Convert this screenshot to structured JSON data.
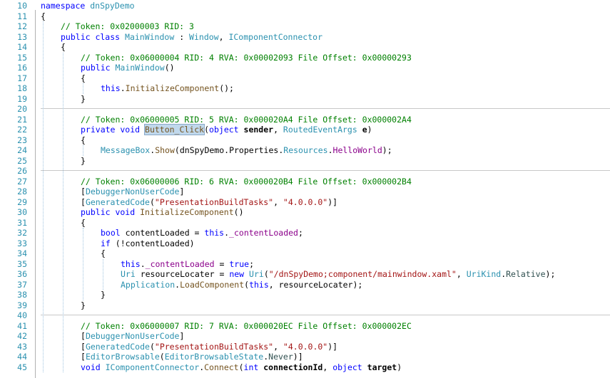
{
  "editor": {
    "lines": [
      {
        "n": "10",
        "indent": 0,
        "tokens": [
          {
            "t": "namespace",
            "c": "kw"
          },
          {
            "t": " dnSpyDemo",
            "c": "ty"
          }
        ]
      },
      {
        "n": "11",
        "indent": 0,
        "tokens": [
          {
            "t": "{",
            "c": "df"
          }
        ]
      },
      {
        "n": "12",
        "indent": 1,
        "tokens": [
          {
            "t": "// Token: 0x02000003 RID: 3",
            "c": "cm"
          }
        ]
      },
      {
        "n": "13",
        "indent": 1,
        "tokens": [
          {
            "t": "public class ",
            "c": "kw"
          },
          {
            "t": "MainWindow",
            "c": "ty"
          },
          {
            "t": " : ",
            "c": "df"
          },
          {
            "t": "Window",
            "c": "ty"
          },
          {
            "t": ", ",
            "c": "df"
          },
          {
            "t": "IComponentConnector",
            "c": "ty"
          }
        ]
      },
      {
        "n": "14",
        "indent": 1,
        "tokens": [
          {
            "t": "{",
            "c": "df"
          }
        ]
      },
      {
        "n": "15",
        "indent": 2,
        "tokens": [
          {
            "t": "// Token: 0x06000004 RID: 4 RVA: 0x00002093 File Offset: 0x00000293",
            "c": "cm"
          }
        ]
      },
      {
        "n": "16",
        "indent": 2,
        "tokens": [
          {
            "t": "public ",
            "c": "kw"
          },
          {
            "t": "MainWindow",
            "c": "ty"
          },
          {
            "t": "()",
            "c": "df"
          }
        ]
      },
      {
        "n": "17",
        "indent": 2,
        "tokens": [
          {
            "t": "{",
            "c": "df"
          }
        ]
      },
      {
        "n": "18",
        "indent": 3,
        "tokens": [
          {
            "t": "this",
            "c": "kw"
          },
          {
            "t": ".",
            "c": "df"
          },
          {
            "t": "InitializeComponent",
            "c": "mt"
          },
          {
            "t": "();",
            "c": "df"
          }
        ]
      },
      {
        "n": "19",
        "indent": 2,
        "tokens": [
          {
            "t": "}",
            "c": "df"
          }
        ]
      },
      {
        "n": "20",
        "indent": 0,
        "sep": true,
        "tokens": []
      },
      {
        "n": "21",
        "indent": 2,
        "tokens": [
          {
            "t": "// Token: 0x06000005 RID: 5 RVA: 0x000020A4 File Offset: 0x000002A4",
            "c": "cm"
          }
        ]
      },
      {
        "n": "22",
        "indent": 2,
        "tokens": [
          {
            "t": "private void ",
            "c": "kw"
          },
          {
            "t": "Button_Click",
            "c": "mt hl"
          },
          {
            "t": "(",
            "c": "df"
          },
          {
            "t": "object ",
            "c": "kw"
          },
          {
            "t": "sender",
            "c": "df bold"
          },
          {
            "t": ", ",
            "c": "df"
          },
          {
            "t": "RoutedEventArgs ",
            "c": "ty"
          },
          {
            "t": "e",
            "c": "df bold"
          },
          {
            "t": ")",
            "c": "df"
          }
        ]
      },
      {
        "n": "23",
        "indent": 2,
        "tokens": [
          {
            "t": "{",
            "c": "df"
          }
        ]
      },
      {
        "n": "24",
        "indent": 3,
        "tokens": [
          {
            "t": "MessageBox",
            "c": "ty"
          },
          {
            "t": ".",
            "c": "df"
          },
          {
            "t": "Show",
            "c": "mt"
          },
          {
            "t": "(",
            "c": "df"
          },
          {
            "t": "dnSpyDemo",
            "c": "df"
          },
          {
            "t": ".",
            "c": "df"
          },
          {
            "t": "Properties",
            "c": "df"
          },
          {
            "t": ".",
            "c": "df"
          },
          {
            "t": "Resources",
            "c": "ty"
          },
          {
            "t": ".",
            "c": "df"
          },
          {
            "t": "HelloWorld",
            "c": "pr"
          },
          {
            "t": ");",
            "c": "df"
          }
        ]
      },
      {
        "n": "25",
        "indent": 2,
        "tokens": [
          {
            "t": "}",
            "c": "df"
          }
        ]
      },
      {
        "n": "26",
        "indent": 0,
        "sep": true,
        "tokens": []
      },
      {
        "n": "27",
        "indent": 2,
        "tokens": [
          {
            "t": "// Token: 0x06000006 RID: 6 RVA: 0x000020B4 File Offset: 0x000002B4",
            "c": "cm"
          }
        ]
      },
      {
        "n": "28",
        "indent": 2,
        "tokens": [
          {
            "t": "[",
            "c": "df"
          },
          {
            "t": "DebuggerNonUserCode",
            "c": "ty"
          },
          {
            "t": "]",
            "c": "df"
          }
        ]
      },
      {
        "n": "29",
        "indent": 2,
        "tokens": [
          {
            "t": "[",
            "c": "df"
          },
          {
            "t": "GeneratedCode",
            "c": "ty"
          },
          {
            "t": "(",
            "c": "df"
          },
          {
            "t": "\"PresentationBuildTasks\"",
            "c": "st"
          },
          {
            "t": ", ",
            "c": "df"
          },
          {
            "t": "\"4.0.0.0\"",
            "c": "st"
          },
          {
            "t": ")]",
            "c": "df"
          }
        ]
      },
      {
        "n": "30",
        "indent": 2,
        "tokens": [
          {
            "t": "public void ",
            "c": "kw"
          },
          {
            "t": "InitializeComponent",
            "c": "mt"
          },
          {
            "t": "()",
            "c": "df"
          }
        ]
      },
      {
        "n": "31",
        "indent": 2,
        "tokens": [
          {
            "t": "{",
            "c": "df"
          }
        ]
      },
      {
        "n": "32",
        "indent": 3,
        "tokens": [
          {
            "t": "bool ",
            "c": "kw"
          },
          {
            "t": "contentLoaded = ",
            "c": "df"
          },
          {
            "t": "this",
            "c": "kw"
          },
          {
            "t": ".",
            "c": "df"
          },
          {
            "t": "_contentLoaded",
            "c": "pr"
          },
          {
            "t": ";",
            "c": "df"
          }
        ]
      },
      {
        "n": "33",
        "indent": 3,
        "tokens": [
          {
            "t": "if ",
            "c": "kw"
          },
          {
            "t": "(!contentLoaded)",
            "c": "df"
          }
        ]
      },
      {
        "n": "34",
        "indent": 3,
        "tokens": [
          {
            "t": "{",
            "c": "df"
          }
        ]
      },
      {
        "n": "35",
        "indent": 4,
        "tokens": [
          {
            "t": "this",
            "c": "kw"
          },
          {
            "t": ".",
            "c": "df"
          },
          {
            "t": "_contentLoaded",
            "c": "pr"
          },
          {
            "t": " = ",
            "c": "df"
          },
          {
            "t": "true",
            "c": "kw"
          },
          {
            "t": ";",
            "c": "df"
          }
        ]
      },
      {
        "n": "36",
        "indent": 4,
        "tokens": [
          {
            "t": "Uri ",
            "c": "ty"
          },
          {
            "t": "resourceLocater = ",
            "c": "df"
          },
          {
            "t": "new ",
            "c": "kw"
          },
          {
            "t": "Uri",
            "c": "ty"
          },
          {
            "t": "(",
            "c": "df"
          },
          {
            "t": "\"/dnSpyDemo;component/mainwindow.xaml\"",
            "c": "st"
          },
          {
            "t": ", ",
            "c": "df"
          },
          {
            "t": "UriKind",
            "c": "ty"
          },
          {
            "t": ".",
            "c": "df"
          },
          {
            "t": "Relative",
            "c": "en"
          },
          {
            "t": ");",
            "c": "df"
          }
        ]
      },
      {
        "n": "37",
        "indent": 4,
        "tokens": [
          {
            "t": "Application",
            "c": "ty"
          },
          {
            "t": ".",
            "c": "df"
          },
          {
            "t": "LoadComponent",
            "c": "mt"
          },
          {
            "t": "(",
            "c": "df"
          },
          {
            "t": "this",
            "c": "kw"
          },
          {
            "t": ", resourceLocater);",
            "c": "df"
          }
        ]
      },
      {
        "n": "38",
        "indent": 3,
        "tokens": [
          {
            "t": "}",
            "c": "df"
          }
        ]
      },
      {
        "n": "39",
        "indent": 2,
        "tokens": [
          {
            "t": "}",
            "c": "df"
          }
        ]
      },
      {
        "n": "40",
        "indent": 0,
        "sep": true,
        "tokens": []
      },
      {
        "n": "41",
        "indent": 2,
        "tokens": [
          {
            "t": "// Token: 0x06000007 RID: 7 RVA: 0x000020EC File Offset: 0x000002EC",
            "c": "cm"
          }
        ]
      },
      {
        "n": "42",
        "indent": 2,
        "tokens": [
          {
            "t": "[",
            "c": "df"
          },
          {
            "t": "DebuggerNonUserCode",
            "c": "ty"
          },
          {
            "t": "]",
            "c": "df"
          }
        ]
      },
      {
        "n": "43",
        "indent": 2,
        "tokens": [
          {
            "t": "[",
            "c": "df"
          },
          {
            "t": "GeneratedCode",
            "c": "ty"
          },
          {
            "t": "(",
            "c": "df"
          },
          {
            "t": "\"PresentationBuildTasks\"",
            "c": "st"
          },
          {
            "t": ", ",
            "c": "df"
          },
          {
            "t": "\"4.0.0.0\"",
            "c": "st"
          },
          {
            "t": ")]",
            "c": "df"
          }
        ]
      },
      {
        "n": "44",
        "indent": 2,
        "tokens": [
          {
            "t": "[",
            "c": "df"
          },
          {
            "t": "EditorBrowsable",
            "c": "ty"
          },
          {
            "t": "(",
            "c": "df"
          },
          {
            "t": "EditorBrowsableState",
            "c": "ty"
          },
          {
            "t": ".",
            "c": "df"
          },
          {
            "t": "Never",
            "c": "en"
          },
          {
            "t": ")]",
            "c": "df"
          }
        ]
      },
      {
        "n": "45",
        "indent": 2,
        "tokens": [
          {
            "t": "void ",
            "c": "kw"
          },
          {
            "t": "IComponentConnector",
            "c": "ty"
          },
          {
            "t": ".",
            "c": "df"
          },
          {
            "t": "Connect",
            "c": "mt"
          },
          {
            "t": "(",
            "c": "df"
          },
          {
            "t": "int ",
            "c": "kw"
          },
          {
            "t": "connectionId",
            "c": "df bold"
          },
          {
            "t": ", ",
            "c": "df"
          },
          {
            "t": "object ",
            "c": "kw"
          },
          {
            "t": "target",
            "c": "df bold"
          },
          {
            "t": ")",
            "c": "df"
          }
        ]
      }
    ]
  }
}
